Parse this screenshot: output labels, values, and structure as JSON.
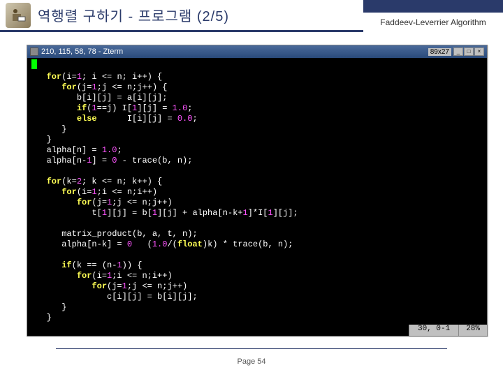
{
  "header": {
    "title": "역행렬 구하기 - 프로그램 (2/5)",
    "algorithm": "Faddeev-Leverrier Algorithm",
    "icon": "reader-icon"
  },
  "terminal": {
    "titlebar_icon": "window-icon",
    "title": "210, 115, 58, 78 - Zterm",
    "dimensions": "89x27",
    "buttons": {
      "minimize": "_",
      "maximize": "□",
      "close": "×"
    },
    "code_lines": [
      {
        "indent": 3,
        "segs": [
          {
            "t": "for",
            "c": "kw"
          },
          {
            "t": "(i="
          },
          {
            "t": "1",
            "c": "num"
          },
          {
            "t": "; i <= n; i++) {"
          }
        ]
      },
      {
        "indent": 6,
        "segs": [
          {
            "t": "for",
            "c": "kw"
          },
          {
            "t": "(j="
          },
          {
            "t": "1",
            "c": "num"
          },
          {
            "t": ";j <= n;j++) {"
          }
        ]
      },
      {
        "indent": 9,
        "segs": [
          {
            "t": "b[i][j] = a[i][j];"
          }
        ]
      },
      {
        "indent": 9,
        "segs": [
          {
            "t": "if",
            "c": "kw"
          },
          {
            "t": "("
          },
          {
            "t": "1",
            "c": "num"
          },
          {
            "t": "==j) I["
          },
          {
            "t": "1",
            "c": "num"
          },
          {
            "t": "][j] = "
          },
          {
            "t": "1.0",
            "c": "num"
          },
          {
            "t": ";"
          }
        ]
      },
      {
        "indent": 9,
        "segs": [
          {
            "t": "else",
            "c": "kw"
          },
          {
            "t": "      I[i][j] = "
          },
          {
            "t": "0.0",
            "c": "num"
          },
          {
            "t": ";"
          }
        ]
      },
      {
        "indent": 6,
        "segs": [
          {
            "t": "}"
          }
        ]
      },
      {
        "indent": 3,
        "segs": [
          {
            "t": "}"
          }
        ]
      },
      {
        "indent": 3,
        "segs": [
          {
            "t": "alpha[n] = "
          },
          {
            "t": "1.0",
            "c": "num"
          },
          {
            "t": ";"
          }
        ]
      },
      {
        "indent": 3,
        "segs": [
          {
            "t": "alpha[n-"
          },
          {
            "t": "1",
            "c": "num"
          },
          {
            "t": "] = "
          },
          {
            "t": "0",
            "c": "num"
          },
          {
            "t": " - trace(b, n);"
          }
        ]
      },
      {
        "indent": 0,
        "segs": [
          {
            "t": ""
          }
        ]
      },
      {
        "indent": 3,
        "segs": [
          {
            "t": "for",
            "c": "kw"
          },
          {
            "t": "(k="
          },
          {
            "t": "2",
            "c": "num"
          },
          {
            "t": "; k <= n; k++) {"
          }
        ]
      },
      {
        "indent": 6,
        "segs": [
          {
            "t": "for",
            "c": "kw"
          },
          {
            "t": "(i="
          },
          {
            "t": "1",
            "c": "num"
          },
          {
            "t": ";i <= n;i++)"
          }
        ]
      },
      {
        "indent": 9,
        "segs": [
          {
            "t": "for",
            "c": "kw"
          },
          {
            "t": "(j="
          },
          {
            "t": "1",
            "c": "num"
          },
          {
            "t": ";j <= n;j++)"
          }
        ]
      },
      {
        "indent": 12,
        "segs": [
          {
            "t": "t["
          },
          {
            "t": "1",
            "c": "num"
          },
          {
            "t": "][j] = b["
          },
          {
            "t": "1",
            "c": "num"
          },
          {
            "t": "][j] + alpha[n-k+"
          },
          {
            "t": "1",
            "c": "num"
          },
          {
            "t": "]*I["
          },
          {
            "t": "1",
            "c": "num"
          },
          {
            "t": "][j];"
          }
        ]
      },
      {
        "indent": 0,
        "segs": [
          {
            "t": ""
          }
        ]
      },
      {
        "indent": 6,
        "segs": [
          {
            "t": "matrix_product(b, a, t, n);"
          }
        ]
      },
      {
        "indent": 6,
        "segs": [
          {
            "t": "alpha[n-k] = "
          },
          {
            "t": "0",
            "c": "num"
          },
          {
            "t": "   ("
          },
          {
            "t": "1.0",
            "c": "num"
          },
          {
            "t": "/("
          },
          {
            "t": "float",
            "c": "kw"
          },
          {
            "t": ")k) * trace(b, n);"
          }
        ]
      },
      {
        "indent": 0,
        "segs": [
          {
            "t": ""
          }
        ]
      },
      {
        "indent": 6,
        "segs": [
          {
            "t": "if",
            "c": "kw"
          },
          {
            "t": "(k == (n-"
          },
          {
            "t": "1",
            "c": "num"
          },
          {
            "t": ")) {"
          }
        ]
      },
      {
        "indent": 9,
        "segs": [
          {
            "t": "for",
            "c": "kw"
          },
          {
            "t": "(i="
          },
          {
            "t": "1",
            "c": "num"
          },
          {
            "t": ";i <= n;i++)"
          }
        ]
      },
      {
        "indent": 12,
        "segs": [
          {
            "t": "for",
            "c": "kw"
          },
          {
            "t": "(j="
          },
          {
            "t": "1",
            "c": "num"
          },
          {
            "t": ";j <= n;j++)"
          }
        ]
      },
      {
        "indent": 15,
        "segs": [
          {
            "t": "c[i][j] = b[i][j];"
          }
        ]
      },
      {
        "indent": 6,
        "segs": [
          {
            "t": "}"
          }
        ]
      },
      {
        "indent": 3,
        "segs": [
          {
            "t": "}"
          }
        ]
      }
    ],
    "status": {
      "position": "30, 0-1",
      "percent": "28%"
    }
  },
  "footer": {
    "page": "Page 54"
  }
}
